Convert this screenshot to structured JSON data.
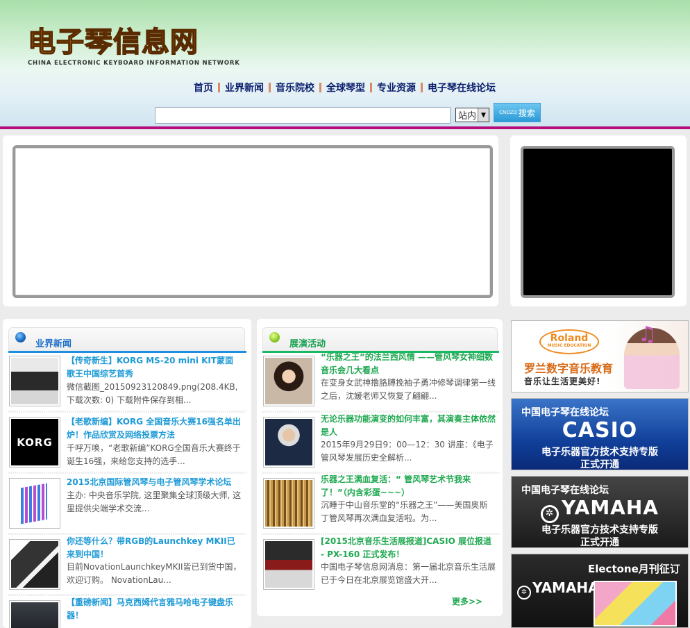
{
  "header": {
    "logo_cn": "电子琴信息网",
    "logo_en": "CHINA ELECTRONIC KEYBOARD INFORMATION NETWORK",
    "nav": [
      "首页",
      "业界新闻",
      "音乐院校",
      "全球琴型",
      "专业资源",
      "电子琴在线论坛"
    ],
    "search": {
      "placeholder": "",
      "scope": "站内",
      "button_prefix": "CNDZQ",
      "button_label": "搜索"
    }
  },
  "industry_news": {
    "title": "业界新闻",
    "items": [
      {
        "title": "【传奇新生】KORG MS-20 mini KIT蒙面歌王中国综艺首秀",
        "desc": "微信截图_20150923120849.png(208.4KB, 下载次数: 0) 下载附件保存到相...",
        "thumb": "synth"
      },
      {
        "title": "【老歌新编】KORG 全国音乐大赛16强名单出炉！作品欣赏及网络投票方法",
        "desc": "千呼万唤，“老歌新编”KORG全国音乐大赛终于诞生16强，来给您支持的选手...",
        "thumb": "korg",
        "thumb_text": "KORG"
      },
      {
        "title": "2015北京国际管风琴与电子管风琴学术论坛",
        "desc": "主办: 中央音乐学院, 这里聚集全球顶级大师, 这里提供尖端学术交流...",
        "thumb": "forum"
      },
      {
        "title": "你还等什么？带RGB的Launchkey MKII已来到中国！",
        "desc": "目前NovationLaunchkeyMKII皆已到货中国，欢迎订购。 NovationLau...",
        "thumb": "launch"
      },
      {
        "title": "【重磅新闻】马克西姆代言雅马哈电子键盘乐器！",
        "desc": "",
        "thumb": "bottom"
      }
    ]
  },
  "events": {
    "title": "展演活动",
    "items": [
      {
        "title": "“乐器之王”的法兰西风情 ——管风琴女神细数音乐会几大看点",
        "desc": "在变身女武神撸胳膊挽袖子勇冲修琴调律第一线之后，沈媛老师又恢复了翩翩...",
        "thumb": "woman"
      },
      {
        "title": "无论乐器功能演变的如何丰富，其演奏主体依然是人",
        "desc": "2015年9月29日9：00—12：30 讲座：《电子管风琴发展历史全解析...",
        "thumb": "man"
      },
      {
        "title": "乐器之王满血复活：“ 管风琴艺术节我来了！”（内含彩蛋~~~）",
        "desc": "沉睡于中山音乐堂的“乐器之王”——美国奥斯丁管风琴再次满血复活啦。为...",
        "thumb": "organ"
      },
      {
        "title": "[2015北京音乐生活展报道]CASIO 展位报道 - PX-160 正式发布！",
        "desc": "中国电子琴信息网消息：第一届北京音乐生活展已于今日在北京展览馆盛大开...",
        "thumb": "casio"
      }
    ],
    "more": "更多>>"
  },
  "ads": {
    "roland": {
      "logo": "Roland",
      "logo_sub": "MUSIC EDUCATION",
      "line1": "罗兰数字音乐教育",
      "line2": "音乐让生活更美好!"
    },
    "casio": {
      "head": "中国电子琴在线论坛",
      "brand": "CASIO",
      "line1": "电子乐器官方技术支持专版",
      "line2": "正式开通"
    },
    "yamaha": {
      "head": "中国电子琴在线论坛",
      "brand": "YAMAHA",
      "line1": "电子乐器官方技术支持专版",
      "line2": "正式开通"
    },
    "electone": {
      "head": "Electone月刊征订",
      "brand": "YAMAHA"
    }
  }
}
